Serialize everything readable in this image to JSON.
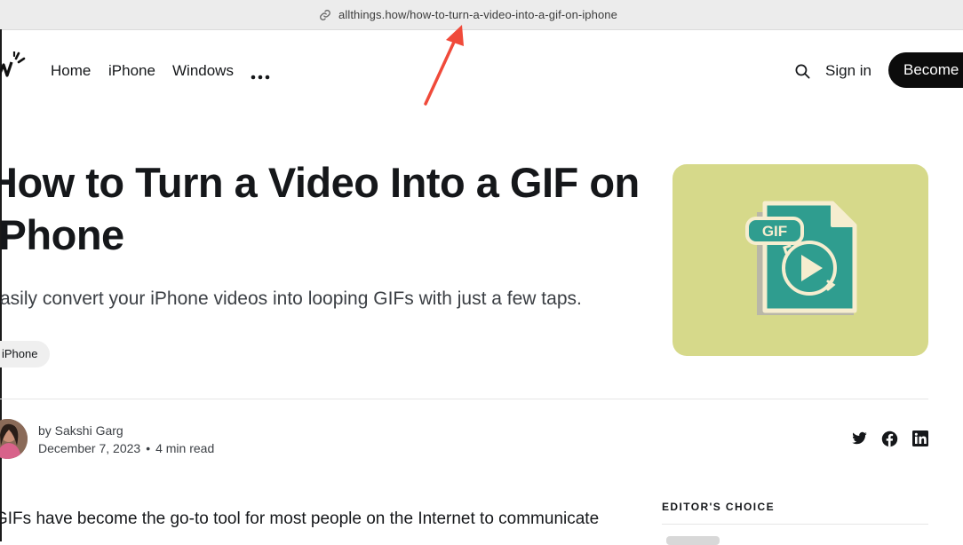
{
  "browser": {
    "url": "allthings.how/how-to-turn-a-video-into-a-gif-on-iphone"
  },
  "nav": {
    "links": [
      "Home",
      "iPhone",
      "Windows"
    ],
    "more_icon": "ellipsis-icon",
    "search_icon": "search-icon",
    "signin": "Sign in",
    "cta": "Become a"
  },
  "article": {
    "title": "How to Turn a Video Into a GIF on iPhone",
    "subtitle": "Easily convert your iPhone videos into looping GIFs with just a few taps.",
    "tag": "iPhone",
    "feature_badge": "GIF",
    "author": "by Sakshi Garg",
    "date": "December 7, 2023",
    "read_time": "4 min read",
    "share_icons": [
      "twitter-icon",
      "facebook-icon",
      "linkedin-icon"
    ],
    "body_first_line": "GIFs have become the go-to tool for most people on the Internet to communicate"
  },
  "sidebar": {
    "heading": "EDITOR'S CHOICE"
  },
  "colors": {
    "feature_bg": "#d6d98a",
    "gif_teal": "#2f9d8f",
    "annotation_arrow": "#f04a3a",
    "button_bg": "#0c0c0c"
  }
}
